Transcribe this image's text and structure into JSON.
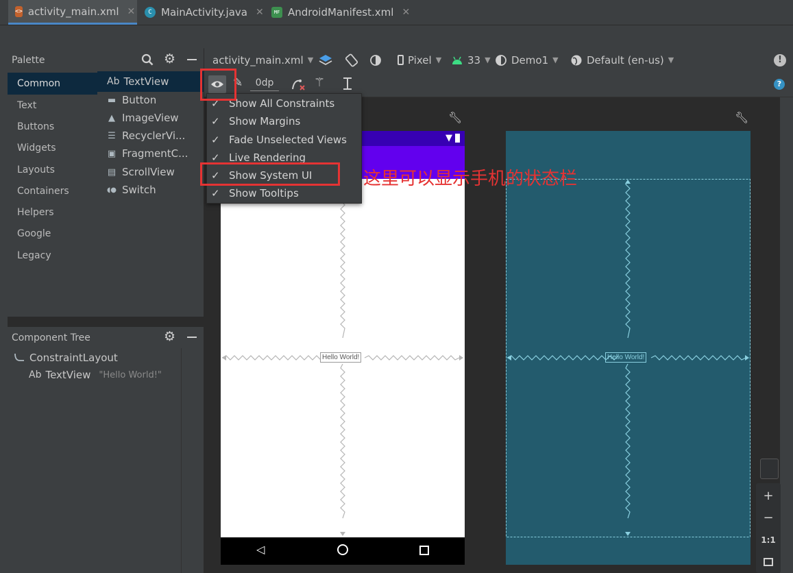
{
  "tabs": [
    {
      "label": "activity_main.xml",
      "icon": "xml-file-icon",
      "active": true
    },
    {
      "label": "MainActivity.java",
      "icon": "java-class-icon",
      "active": false
    },
    {
      "label": "AndroidManifest.xml",
      "icon": "manifest-file-icon",
      "active": false
    }
  ],
  "palette": {
    "title": "Palette",
    "categories": [
      "Common",
      "Text",
      "Buttons",
      "Widgets",
      "Layouts",
      "Containers",
      "Helpers",
      "Google",
      "Legacy"
    ],
    "items": [
      {
        "glyph": "Ab",
        "label": "TextView"
      },
      {
        "glyph": "▬",
        "label": "Button"
      },
      {
        "glyph": "▲",
        "label": "ImageView"
      },
      {
        "glyph": "☰",
        "label": "RecyclerVi..."
      },
      {
        "glyph": "▣",
        "label": "FragmentC..."
      },
      {
        "glyph": "▤",
        "label": "ScrollView"
      },
      {
        "glyph": "◖●",
        "label": "Switch"
      }
    ]
  },
  "component_tree": {
    "title": "Component Tree",
    "root": "ConstraintLayout",
    "child_glyph": "Ab",
    "child": "TextView",
    "child_text": "\"Hello World!\""
  },
  "toolbar": {
    "file": "activity_main.xml",
    "device": "Pixel",
    "api": "33",
    "theme": "Demo1",
    "locale": "Default (en-us)",
    "margin": "0dp"
  },
  "view_options_menu": [
    {
      "label": "Show All Constraints",
      "checked": true
    },
    {
      "label": "Show Margins",
      "checked": true
    },
    {
      "label": "Fade Unselected Views",
      "checked": true
    },
    {
      "label": "Live Rendering",
      "checked": true
    },
    {
      "label": "Show System UI",
      "checked": true
    },
    {
      "label": "Show Tooltips",
      "checked": true
    }
  ],
  "check_glyph": "✓",
  "annotation": "这里可以显示手机的状态栏",
  "design": {
    "hello_text": "Hello World!"
  },
  "zoom": {
    "plus": "+",
    "minus": "−",
    "ratio": "1:1"
  },
  "colors": {
    "status_bar": "#3700b3",
    "action_bar": "#6200ee",
    "blueprint": "#235b6d",
    "highlight": "#e53333"
  }
}
